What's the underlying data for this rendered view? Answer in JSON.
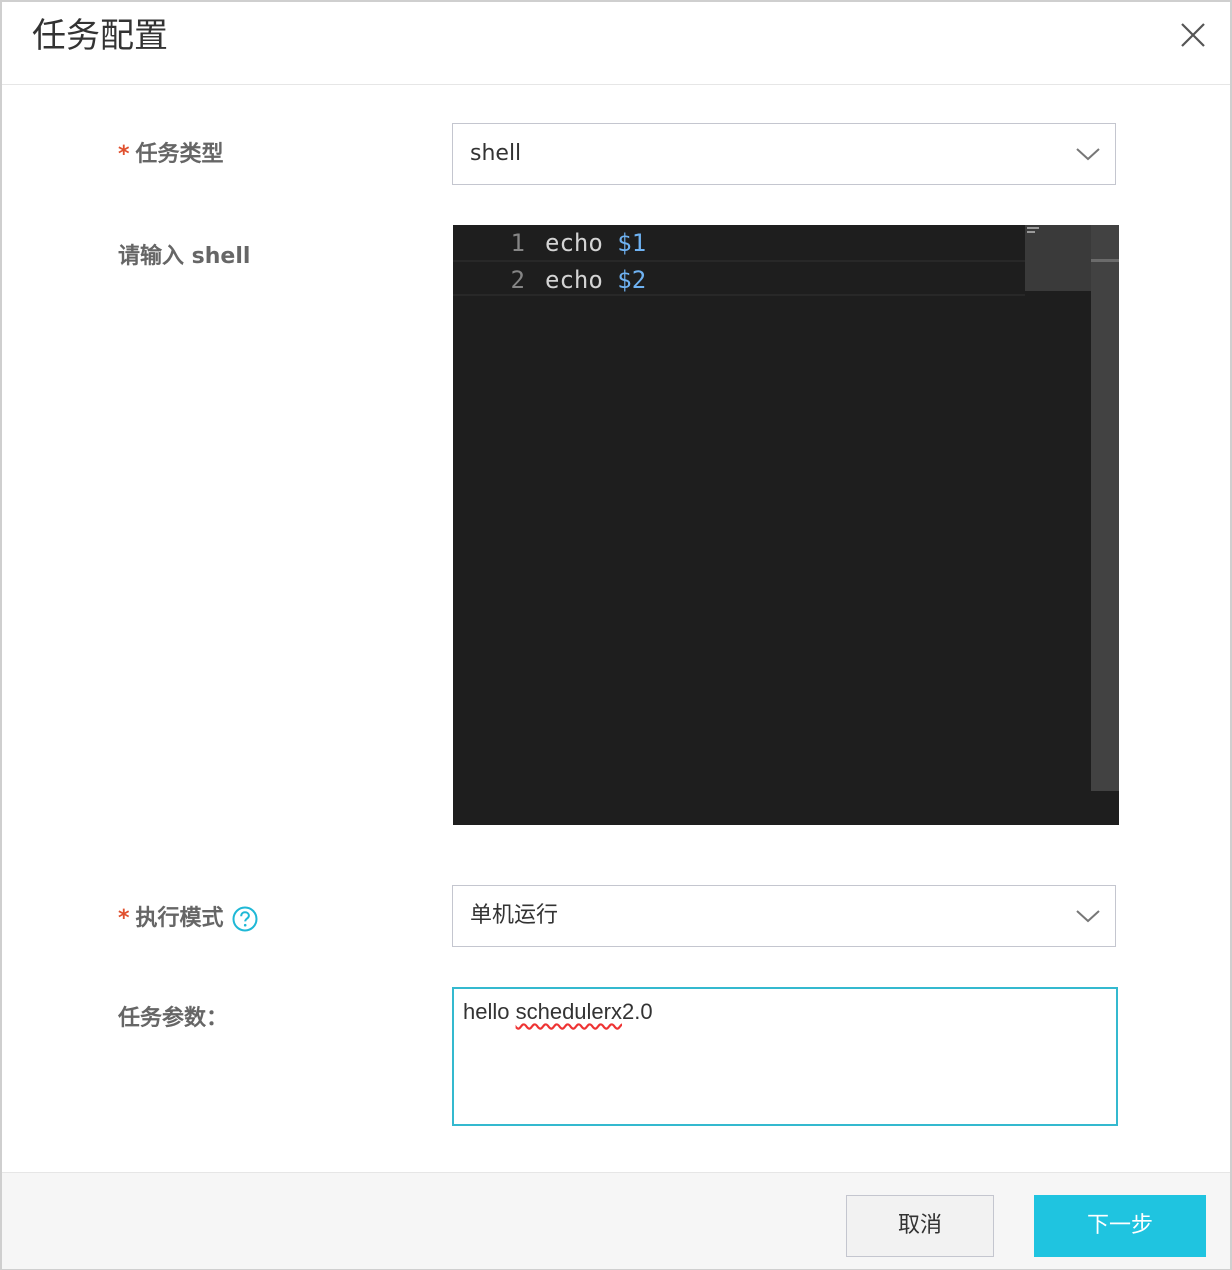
{
  "dialog": {
    "title": "任务配置"
  },
  "form": {
    "task_type": {
      "required_mark": "*",
      "label": "任务类型",
      "value": "shell"
    },
    "shell_input": {
      "label": "请输入 shell",
      "lines": [
        {
          "number": "1",
          "keyword": "echo",
          "variable": "$1"
        },
        {
          "number": "2",
          "keyword": "echo",
          "variable": "$2"
        }
      ]
    },
    "exec_mode": {
      "required_mark": "*",
      "label": "执行模式",
      "value": "单机运行"
    },
    "task_params": {
      "label": "任务参数：",
      "value_prefix": "hello ",
      "value_misspelled": "schedulerx",
      "value_suffix": "2.0"
    }
  },
  "footer": {
    "cancel_label": "取消",
    "next_label": "下一步"
  },
  "colors": {
    "accent": "#1fc4e0",
    "required": "#e0502e",
    "editor_bg": "#1e1e1e",
    "code_variable": "#6fb2f2"
  },
  "icons": [
    "close-icon",
    "chevron-down-icon",
    "help-circle-icon"
  ]
}
